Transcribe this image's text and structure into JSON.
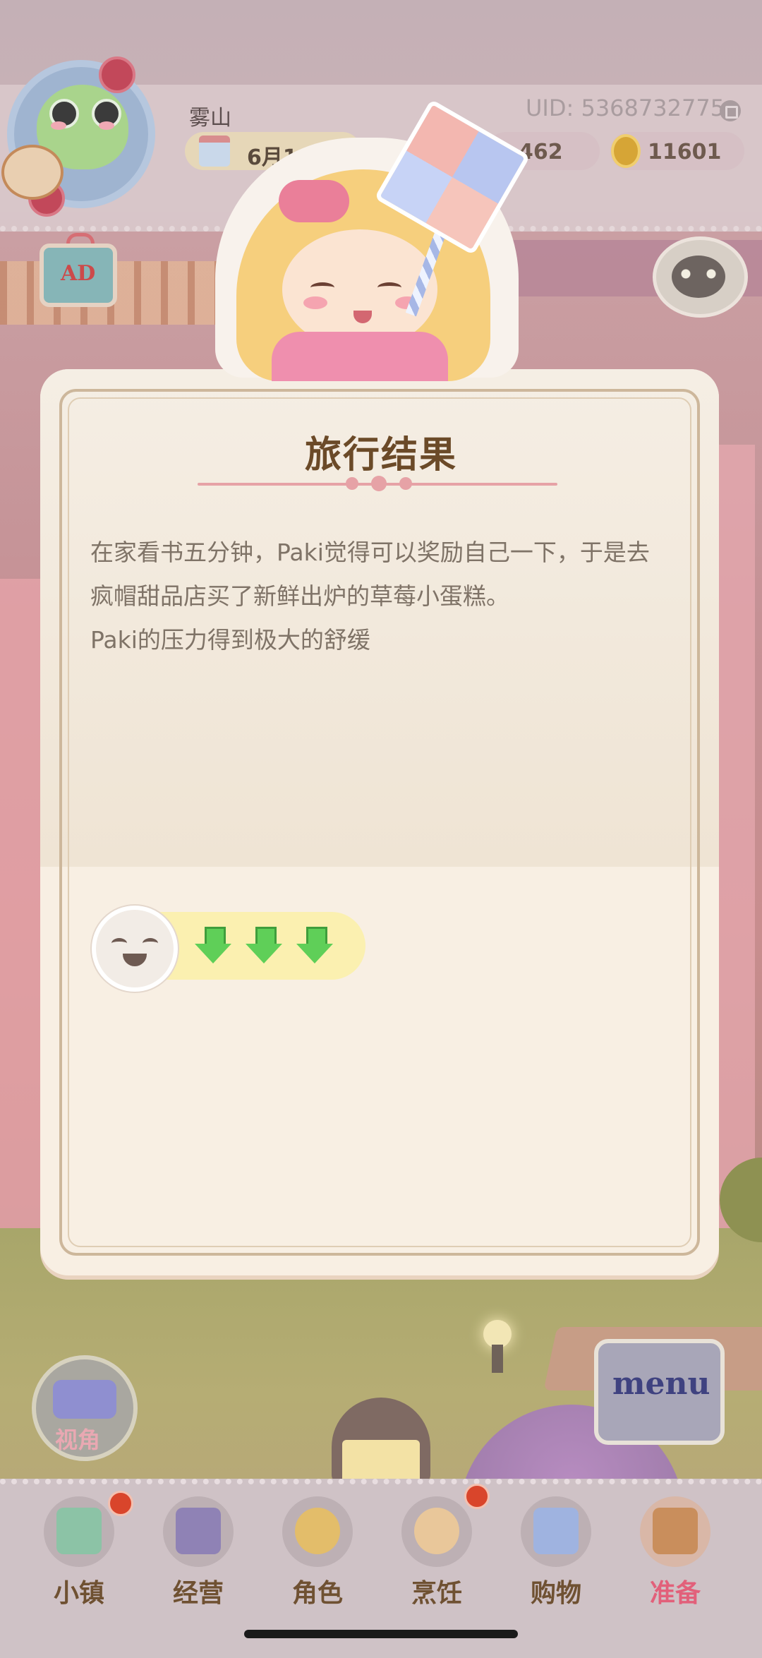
{
  "hud": {
    "player_name": "雾山",
    "uid": "UID: 5368732775",
    "date": "6月11日",
    "stat_value": "462",
    "coins": "11601",
    "ad_label": "AD"
  },
  "dialog": {
    "title": "旅行结果",
    "paragraphs": [
      "在家看书五分钟，Paki觉得可以奖励自己一下，于是去疯帽甜品店买了新鲜出炉的草莓小蛋糕。",
      "Paki的压力得到极大的舒缓"
    ],
    "stress_change_icons": [
      "down-arrow-icon",
      "down-arrow-icon",
      "down-arrow-icon"
    ]
  },
  "side_buttons": {
    "camera_label": "视角",
    "menu_label": "menu"
  },
  "nav": [
    {
      "label": "小镇",
      "icon": "map-icon",
      "badge": true
    },
    {
      "label": "经营",
      "icon": "hat-lock-icon",
      "badge": false
    },
    {
      "label": "角色",
      "icon": "character-icon",
      "badge": false
    },
    {
      "label": "烹饪",
      "icon": "sandwich-icon",
      "badge": true
    },
    {
      "label": "购物",
      "icon": "shopping-bag-icon",
      "badge": false
    },
    {
      "label": "准备",
      "icon": "picnic-basket-icon",
      "badge": false,
      "active": true
    }
  ],
  "colors": {
    "accent_pink": "#e2607a",
    "title_brown": "#6b4a28",
    "arrow_green": "#5fcf58"
  }
}
